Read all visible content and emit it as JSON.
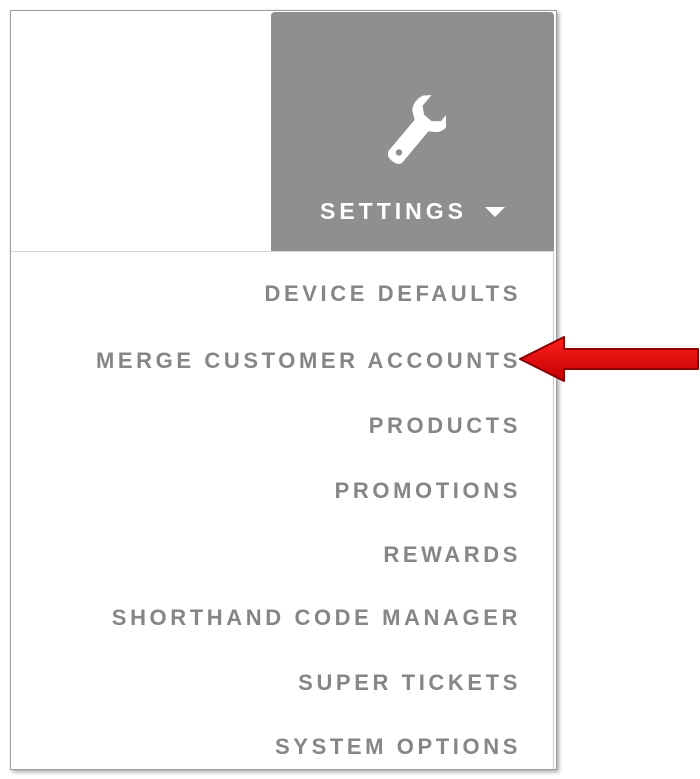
{
  "settings": {
    "label": "SETTINGS",
    "icon": "wrench-icon",
    "caret_icon": "caret-down-icon",
    "background_color": "#8f8f8f"
  },
  "menu": {
    "text_color": "#868686",
    "items": [
      {
        "label": "DEVICE DEFAULTS"
      },
      {
        "label": "MERGE CUSTOMER ACCOUNTS"
      },
      {
        "label": "PRODUCTS"
      },
      {
        "label": "PROMOTIONS"
      },
      {
        "label": "REWARDS"
      },
      {
        "label": "SHORTHAND CODE MANAGER"
      },
      {
        "label": "SUPER TICKETS"
      },
      {
        "label": "SYSTEM OPTIONS"
      }
    ]
  },
  "annotation": {
    "icon": "red-arrow-icon",
    "color": "#e00000",
    "points_to": "MERGE CUSTOMER ACCOUNTS"
  }
}
